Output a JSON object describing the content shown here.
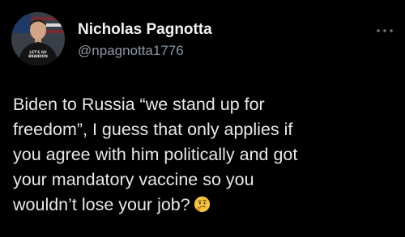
{
  "author": {
    "display_name": "Nicholas Pagnotta",
    "handle": "@npagnotta1776",
    "avatar_shirt_text": "LET'S GO BRANDON"
  },
  "tweet": {
    "lines": [
      "Biden to Russia “we stand up for",
      "freedom”, I guess that only applies if",
      "you agree with him politically and got",
      "your mandatory vaccine so you",
      "wouldn’t lose your job?"
    ],
    "emoji": "thinking-face"
  },
  "icons": {
    "more": "more-horizontal-icon"
  },
  "colors": {
    "background": "#000000",
    "text": "#e7e9ea",
    "handle": "#8b98a5"
  }
}
